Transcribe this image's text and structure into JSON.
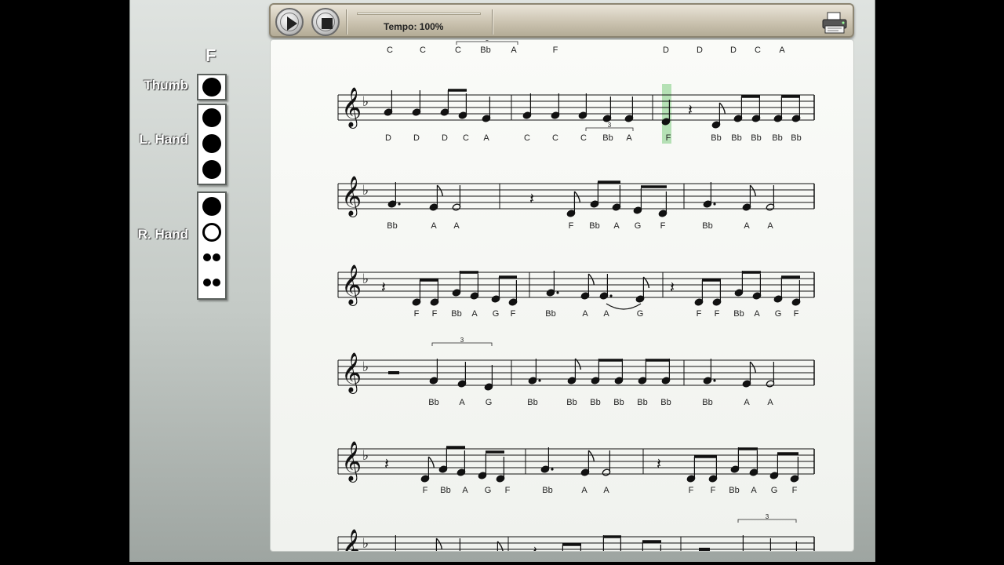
{
  "fingering": {
    "note": "F",
    "thumb_label": "Thumb",
    "left_label": "L. Hand",
    "right_label": "R. Hand",
    "thumb_holes": [
      "closed"
    ],
    "left_holes": [
      "closed",
      "closed",
      "closed"
    ],
    "right_holes": [
      "closed",
      "open",
      "double-closed",
      "double-closed"
    ]
  },
  "toolbar": {
    "tempo_label": "Tempo: 100%",
    "tempo_percent": 100
  },
  "score": {
    "highlight_color": "#a9dca9",
    "top_labels": [
      "C",
      "C",
      "C",
      "Bb",
      "A",
      "F",
      "D",
      "D",
      "D",
      "C",
      "A"
    ],
    "rows": [
      [
        "D",
        "D",
        "D",
        "C",
        "A",
        "C",
        "C",
        "C",
        "Bb",
        "A",
        "F",
        "Bb",
        "Bb",
        "Bb",
        "Bb",
        "Bb"
      ],
      [
        "Bb",
        "A",
        "A",
        "F",
        "Bb",
        "A",
        "G",
        "F",
        "Bb",
        "A",
        "A"
      ],
      [
        "F",
        "F",
        "Bb",
        "A",
        "G",
        "F",
        "Bb",
        "A",
        "A",
        "G",
        "F",
        "F",
        "Bb",
        "A",
        "G",
        "F"
      ],
      [
        "Bb",
        "A",
        "G",
        "Bb",
        "Bb",
        "Bb",
        "Bb",
        "Bb",
        "Bb",
        "Bb",
        "A",
        "A"
      ],
      [
        "F",
        "Bb",
        "A",
        "G",
        "F",
        "Bb",
        "A",
        "A",
        "F",
        "F",
        "Bb",
        "A",
        "G",
        "F"
      ]
    ],
    "triplet_marks": [
      "3",
      "3",
      "3",
      "3"
    ]
  }
}
